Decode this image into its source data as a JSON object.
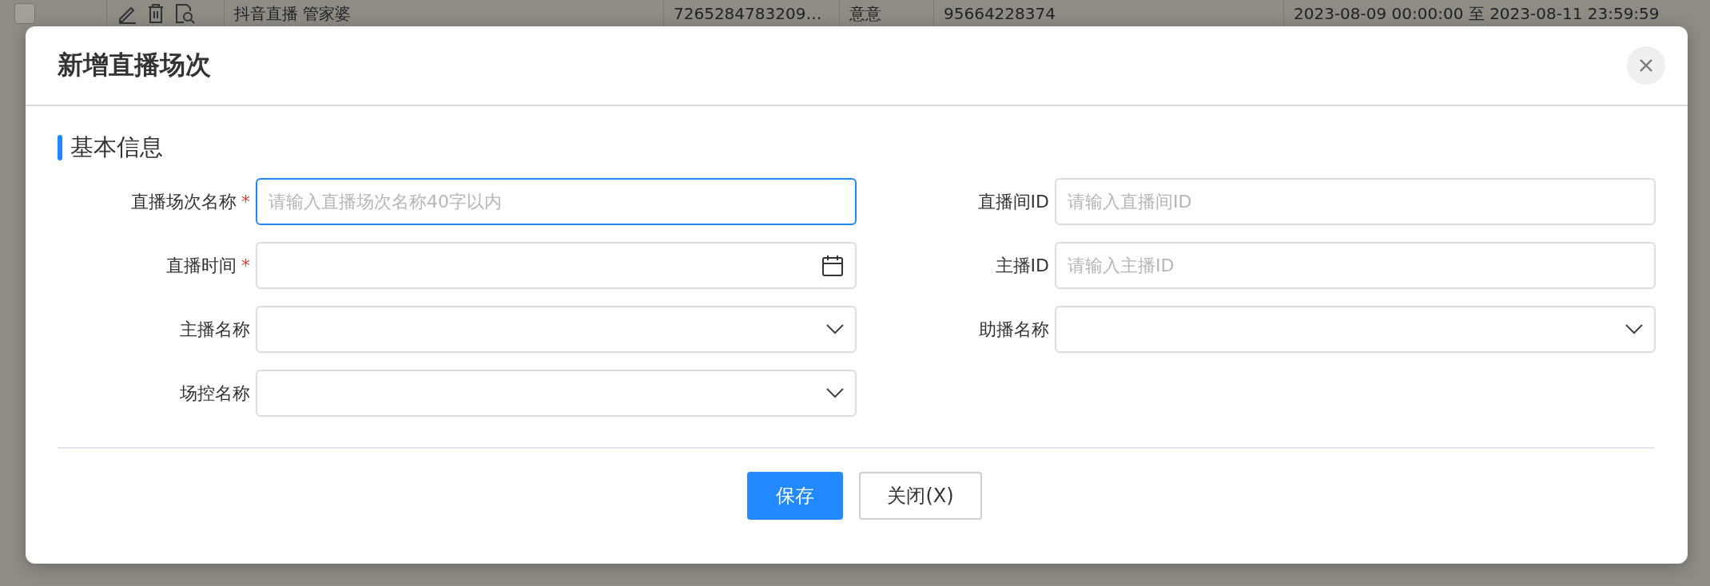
{
  "background_row": {
    "checked": false,
    "cells": [
      "抖音直播 管家婆",
      "7265284783209…",
      "意意",
      "95664228374",
      "2023-08-09 00:00:00 至 2023-08-11 23:59:59"
    ]
  },
  "dialog": {
    "title": "新增直播场次",
    "section": "基本信息",
    "fields": [
      {
        "label": "直播场次名称",
        "required_mark": "*",
        "kind": "text",
        "placeholder": "请输入直播场次名称40字以内",
        "focused": true
      },
      {
        "label": "直播间ID",
        "kind": "text",
        "placeholder": "请输入直播间ID",
        "focused": false
      },
      {
        "label": "直播时间",
        "required_mark": "*",
        "kind": "date",
        "focused": false
      },
      {
        "label": "主播ID",
        "kind": "text",
        "placeholder": "请输入主播ID",
        "focused": false
      },
      {
        "label": "主播名称",
        "kind": "select",
        "focused": false
      },
      {
        "label": "助播名称",
        "kind": "select",
        "focused": false
      },
      {
        "label": "场控名称",
        "kind": "select",
        "focused": false
      }
    ],
    "buttons": [
      {
        "label": "保存",
        "kind": "primary"
      },
      {
        "label": "关闭(X)",
        "kind": "default"
      }
    ]
  }
}
